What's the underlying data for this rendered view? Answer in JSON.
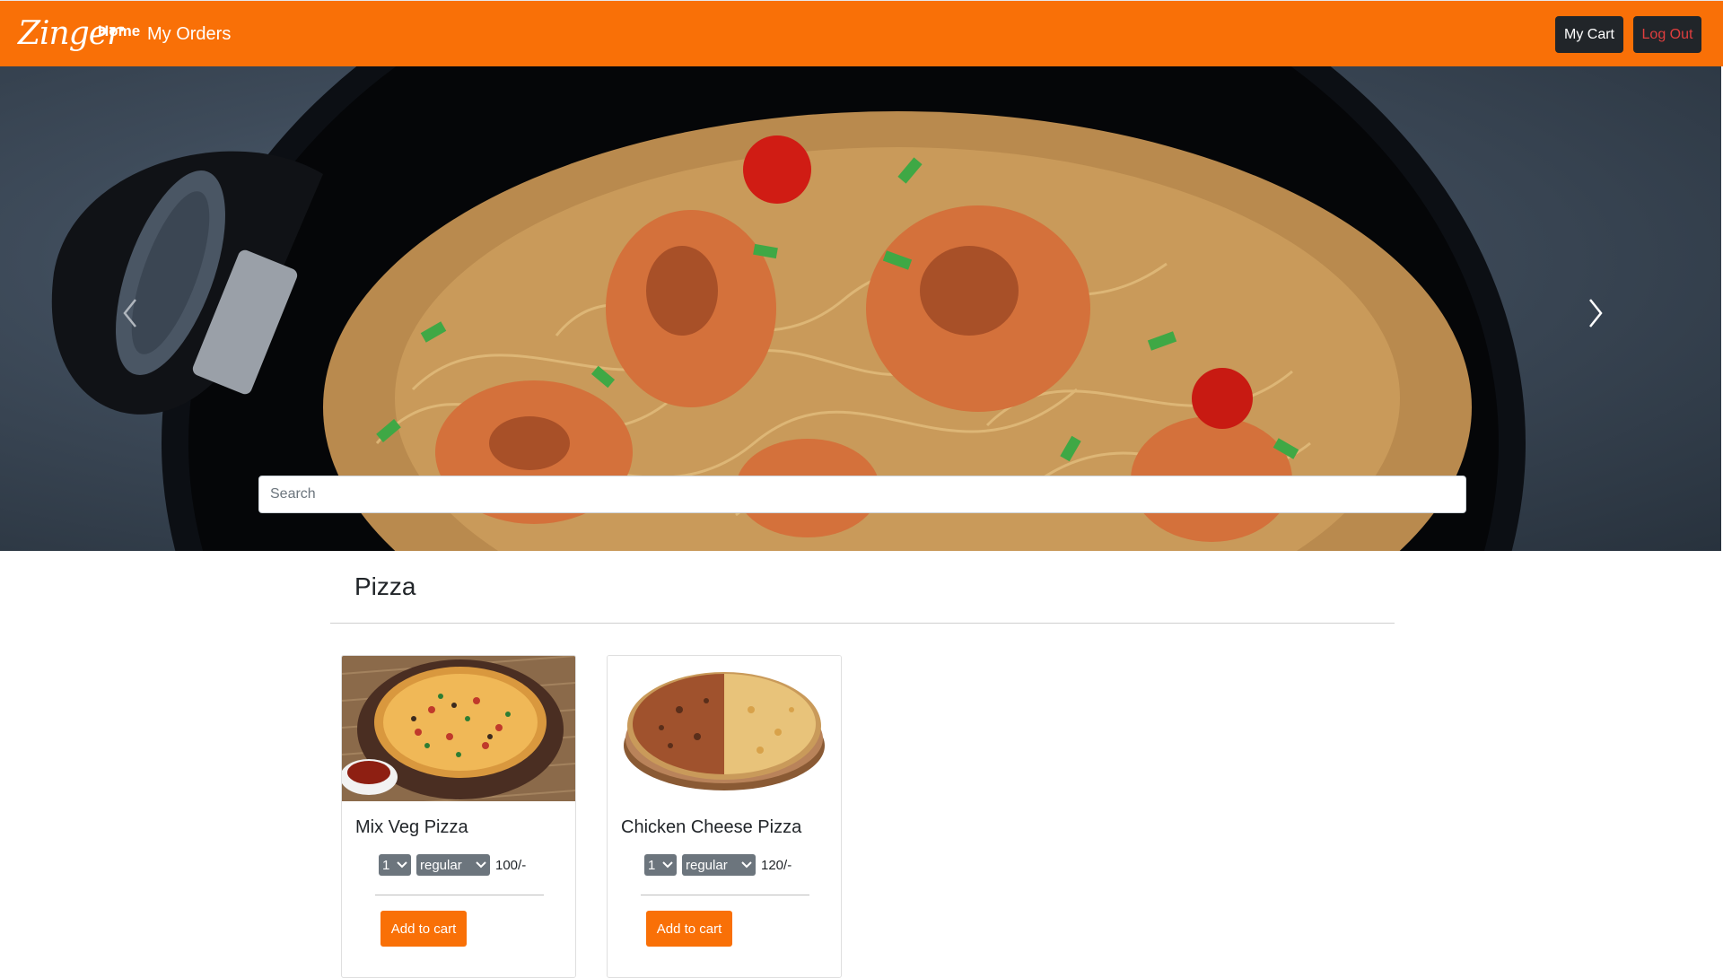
{
  "nav": {
    "brand": "Zinger",
    "home": "Home",
    "my_orders": "My Orders",
    "my_cart": "My Cart",
    "log_out": "Log Out"
  },
  "carousel": {
    "prev_icon": "chevron-left-icon",
    "next_icon": "chevron-right-icon"
  },
  "search": {
    "placeholder": "Search"
  },
  "category": {
    "title": "Pizza"
  },
  "products": [
    {
      "name": "Mix Veg Pizza",
      "quantity": "1",
      "size": "regular",
      "price": "100/-",
      "add_label": "Add to cart"
    },
    {
      "name": "Chicken Cheese Pizza",
      "quantity": "1",
      "size": "regular",
      "price": "120/-",
      "add_label": "Add to cart"
    }
  ],
  "colors": {
    "primary": "#f97007",
    "dark": "#212529",
    "logout_text": "#e03e3e",
    "select_bg": "#6c757d"
  }
}
